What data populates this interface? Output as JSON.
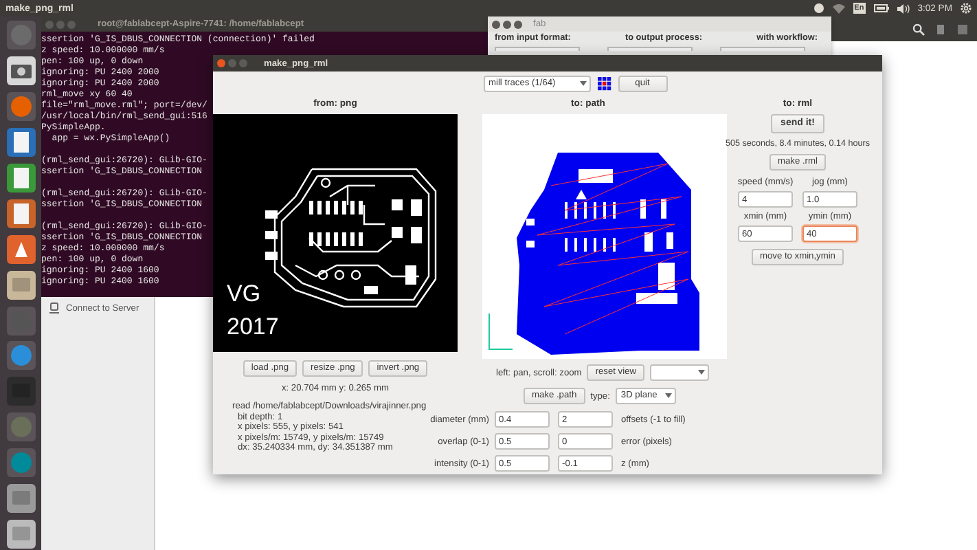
{
  "top_bar": {
    "title": "make_png_rml",
    "keyboard": "En",
    "time": "3:02 PM"
  },
  "terminal": {
    "title": "root@fablabcept-Aspire-7741: /home/fablabcept",
    "blocks": [
      [
        "ssertion 'G_IS_DBUS_CONNECTION (connection)' failed",
        "z speed: 10.000000 mm/s",
        "pen: 100 up, 0 down",
        "ignoring: PU 2400 2000",
        "ignoring: PU 2400 2000",
        "rml_move xy 60 40",
        "file=\"rml_move.rml\"; port=/dev/",
        "/usr/local/bin/rml_send_gui:516",
        "PySimpleApp.",
        "  app = wx.PySimpleApp()"
      ],
      [
        "(rml_send_gui:26720): GLib-GIO-",
        "ssertion 'G_IS_DBUS_CONNECTION"
      ],
      [
        "(rml_send_gui:26720): GLib-GIO-",
        "ssertion 'G_IS_DBUS_CONNECTION"
      ],
      [
        "(rml_send_gui:26720): GLib-GIO-",
        "ssertion 'G_IS_DBUS_CONNECTION",
        "z speed: 10.000000 mm/s",
        "pen: 100 up, 0 down",
        "ignoring: PU 2400 1600",
        "ignoring: PU 2400 1600"
      ]
    ]
  },
  "file_manager": {
    "sidebar_items": [
      "Connect to Server"
    ]
  },
  "fab_window": {
    "title": "fab",
    "labels": [
      "from input format:",
      "to output process:",
      "with workflow:"
    ]
  },
  "main_window": {
    "title": "make_png_rml",
    "mode_select": "mill traces (1/64)",
    "quit": "quit",
    "png": {
      "heading": "from: png",
      "image_text": [
        "VG",
        "2017"
      ],
      "buttons": [
        "load .png",
        "resize .png",
        "invert .png"
      ],
      "coords": "x: 20.704 mm  y: 0.265 mm",
      "info": [
        "read /home/fablabcept/Downloads/virajinner.png",
        "bit depth: 1",
        "x pixels: 555, y pixels: 541",
        "x pixels/m: 15749, y pixels/m: 15749",
        "dx: 35.240334 mm, dy: 34.351387 mm"
      ]
    },
    "path": {
      "heading": "to: path",
      "view_hint": "left: pan, scroll: zoom",
      "reset": "reset view",
      "make": "make .path",
      "type_label": "type:",
      "type_value": "3D plane",
      "params": [
        {
          "label": "diameter (mm)",
          "value_1": "0.4",
          "value_2": "2",
          "note": "offsets (-1 to fill)"
        },
        {
          "label": "overlap (0-1)",
          "value_1": "0.5",
          "value_2": "0",
          "note": "error (pixels)"
        },
        {
          "label": "intensity (0-1)",
          "value_1": "0.5",
          "value_2": "-0.1",
          "note": "z (mm)"
        }
      ]
    },
    "rml": {
      "heading": "to: rml",
      "send": "send it!",
      "estimate": "505 seconds, 8.4 minutes, 0.14 hours",
      "make": "make .rml",
      "fields": [
        {
          "label": "speed (mm/s)",
          "value": "4",
          "focused": false
        },
        {
          "label": "jog (mm)",
          "value": "1.0",
          "focused": false
        },
        {
          "label": "xmin (mm)",
          "value": "60",
          "focused": false
        },
        {
          "label": "ymin (mm)",
          "value": "40",
          "focused": true
        }
      ],
      "move": "move to xmin,ymin"
    }
  }
}
